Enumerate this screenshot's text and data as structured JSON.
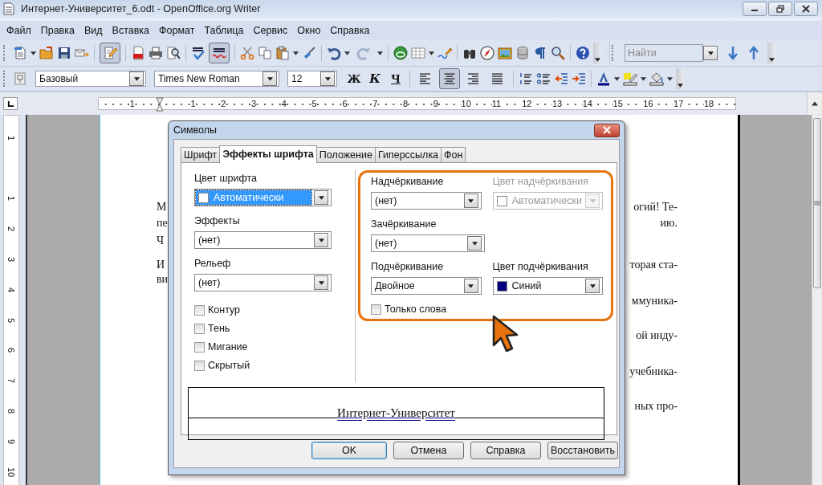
{
  "window": {
    "title": "Интернет-Университет_6.odt - OpenOffice.org Writer"
  },
  "menu": [
    {
      "label": "Файл"
    },
    {
      "label": "Правка"
    },
    {
      "label": "Вид"
    },
    {
      "label": "Вставка"
    },
    {
      "label": "Формат"
    },
    {
      "label": "Таблица"
    },
    {
      "label": "Сервис"
    },
    {
      "label": "Окно"
    },
    {
      "label": "Справка"
    }
  ],
  "standard_toolbar": {
    "edit_file": {
      "pressed": true
    },
    "autospellcheck": {
      "pressed": true
    },
    "redo": {
      "disabled": true
    }
  },
  "find_toolbar": {
    "search": {
      "placeholder": "Найти"
    }
  },
  "formatting_toolbar": {
    "paragraph_style": "Базовый",
    "font_name": "Times New Roman",
    "font_size": "12",
    "style_buttons": [
      "Ж",
      "К",
      "Ч"
    ],
    "alignment": [
      {
        "selected": false
      },
      {
        "selected": true
      },
      {
        "selected": false
      },
      {
        "selected": false
      }
    ]
  },
  "horizontal_ruler": [
    "1",
    "1",
    "2",
    "3",
    "4",
    "5",
    "6",
    "7",
    "8",
    "9",
    "10",
    "11",
    "12",
    "13",
    "14",
    "15",
    "16",
    "17",
    "18"
  ],
  "vertical_ruler": [
    "1",
    "1",
    "2",
    "3",
    "4",
    "5",
    "6",
    "7",
    "8",
    "9",
    "10"
  ],
  "document_lines": [
    {
      "left": "М",
      "right": "огий! Те-"
    },
    {
      "left": "пе",
      "right": "ию."
    },
    {
      "left": "Ч"
    },
    {
      "left": "И",
      "right": "торая ста-"
    },
    {
      "left": "ви"
    },
    {
      "right": "ммуника-"
    },
    {
      "right": "ой инду-"
    },
    {
      "right": "учебника-"
    },
    {
      "right": "ных про-"
    }
  ],
  "dialog": {
    "title": "Символы",
    "tabs": [
      {
        "label": "Шрифт",
        "selected": false
      },
      {
        "label": "Эффекты шрифта",
        "selected": true
      },
      {
        "label": "Положение",
        "selected": false
      },
      {
        "label": "Гиперссылка",
        "selected": false
      },
      {
        "label": "Фон",
        "selected": false
      }
    ],
    "left_fields": [
      {
        "label": "Цвет шрифта",
        "value": "Автоматически",
        "color": "#ffffff",
        "focused": true,
        "disabled": false
      },
      {
        "label": "Эффекты",
        "value": "(нет)",
        "focused": false,
        "disabled": false
      },
      {
        "label": "Рельеф",
        "value": "(нет)",
        "focused": false,
        "disabled": false
      }
    ],
    "checkboxes": [
      {
        "label": "Контур",
        "checked": false
      },
      {
        "label": "Тень",
        "checked": false
      },
      {
        "label": "Мигание",
        "checked": false
      },
      {
        "label": "Скрытый",
        "checked": false
      }
    ],
    "right_rows": [
      [
        {
          "label": "Надчёркивание",
          "value": "(нет)",
          "focused": false,
          "disabled": false
        },
        {
          "label": "Цвет надчёркивания",
          "value": "Автоматически",
          "color": "#ffffff",
          "focused": false,
          "disabled": true
        }
      ],
      [
        {
          "label": "Зачёркивание",
          "value": "(нет)",
          "focused": false,
          "disabled": false
        }
      ],
      [
        {
          "label": "Подчёркивание",
          "value": "Двойное",
          "focused": false,
          "disabled": false
        },
        {
          "label": "Цвет подчёркивания",
          "value": "Синий",
          "color": "#000080",
          "focused": false,
          "disabled": false
        }
      ]
    ],
    "words_only": {
      "label": "Только слова",
      "checked": false
    },
    "preview_text": "Интернет-Университет",
    "buttons": [
      {
        "label": "OK",
        "default": true
      },
      {
        "label": "Отмена",
        "default": false
      },
      {
        "label": "Справка",
        "default": false
      },
      {
        "label": "Восстановить",
        "default": false
      }
    ]
  }
}
